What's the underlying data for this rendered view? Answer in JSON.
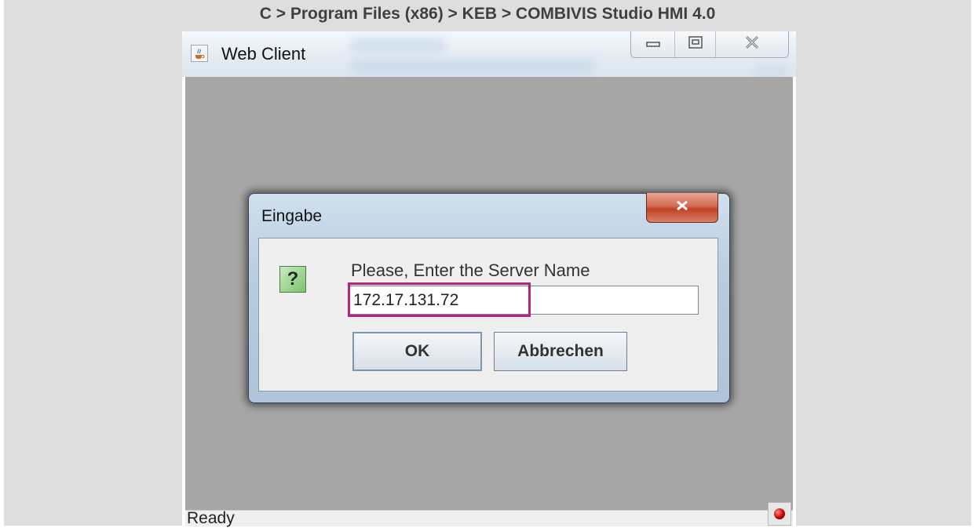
{
  "breadcrumb": "C > Program Files (x86) > KEB > COMBIVIS Studio HMI 4.0",
  "window": {
    "title": "Web Client",
    "icon": "java-cup-icon",
    "controls": [
      "minimize-icon",
      "maximize-icon",
      "close-icon"
    ]
  },
  "dialog": {
    "title": "Eingabe",
    "icon": "question-icon",
    "icon_glyph": "?",
    "prompt": "Please, Enter the Server Name",
    "input_value": "172.17.131.72",
    "ok_label": "OK",
    "cancel_label": "Abbrechen"
  },
  "statusbar": {
    "text": "Ready",
    "indicator": "red-led-icon"
  },
  "colors": {
    "highlight": "#b3257e",
    "content_bg": "#a6a6a6",
    "page_bg": "#dedede"
  }
}
